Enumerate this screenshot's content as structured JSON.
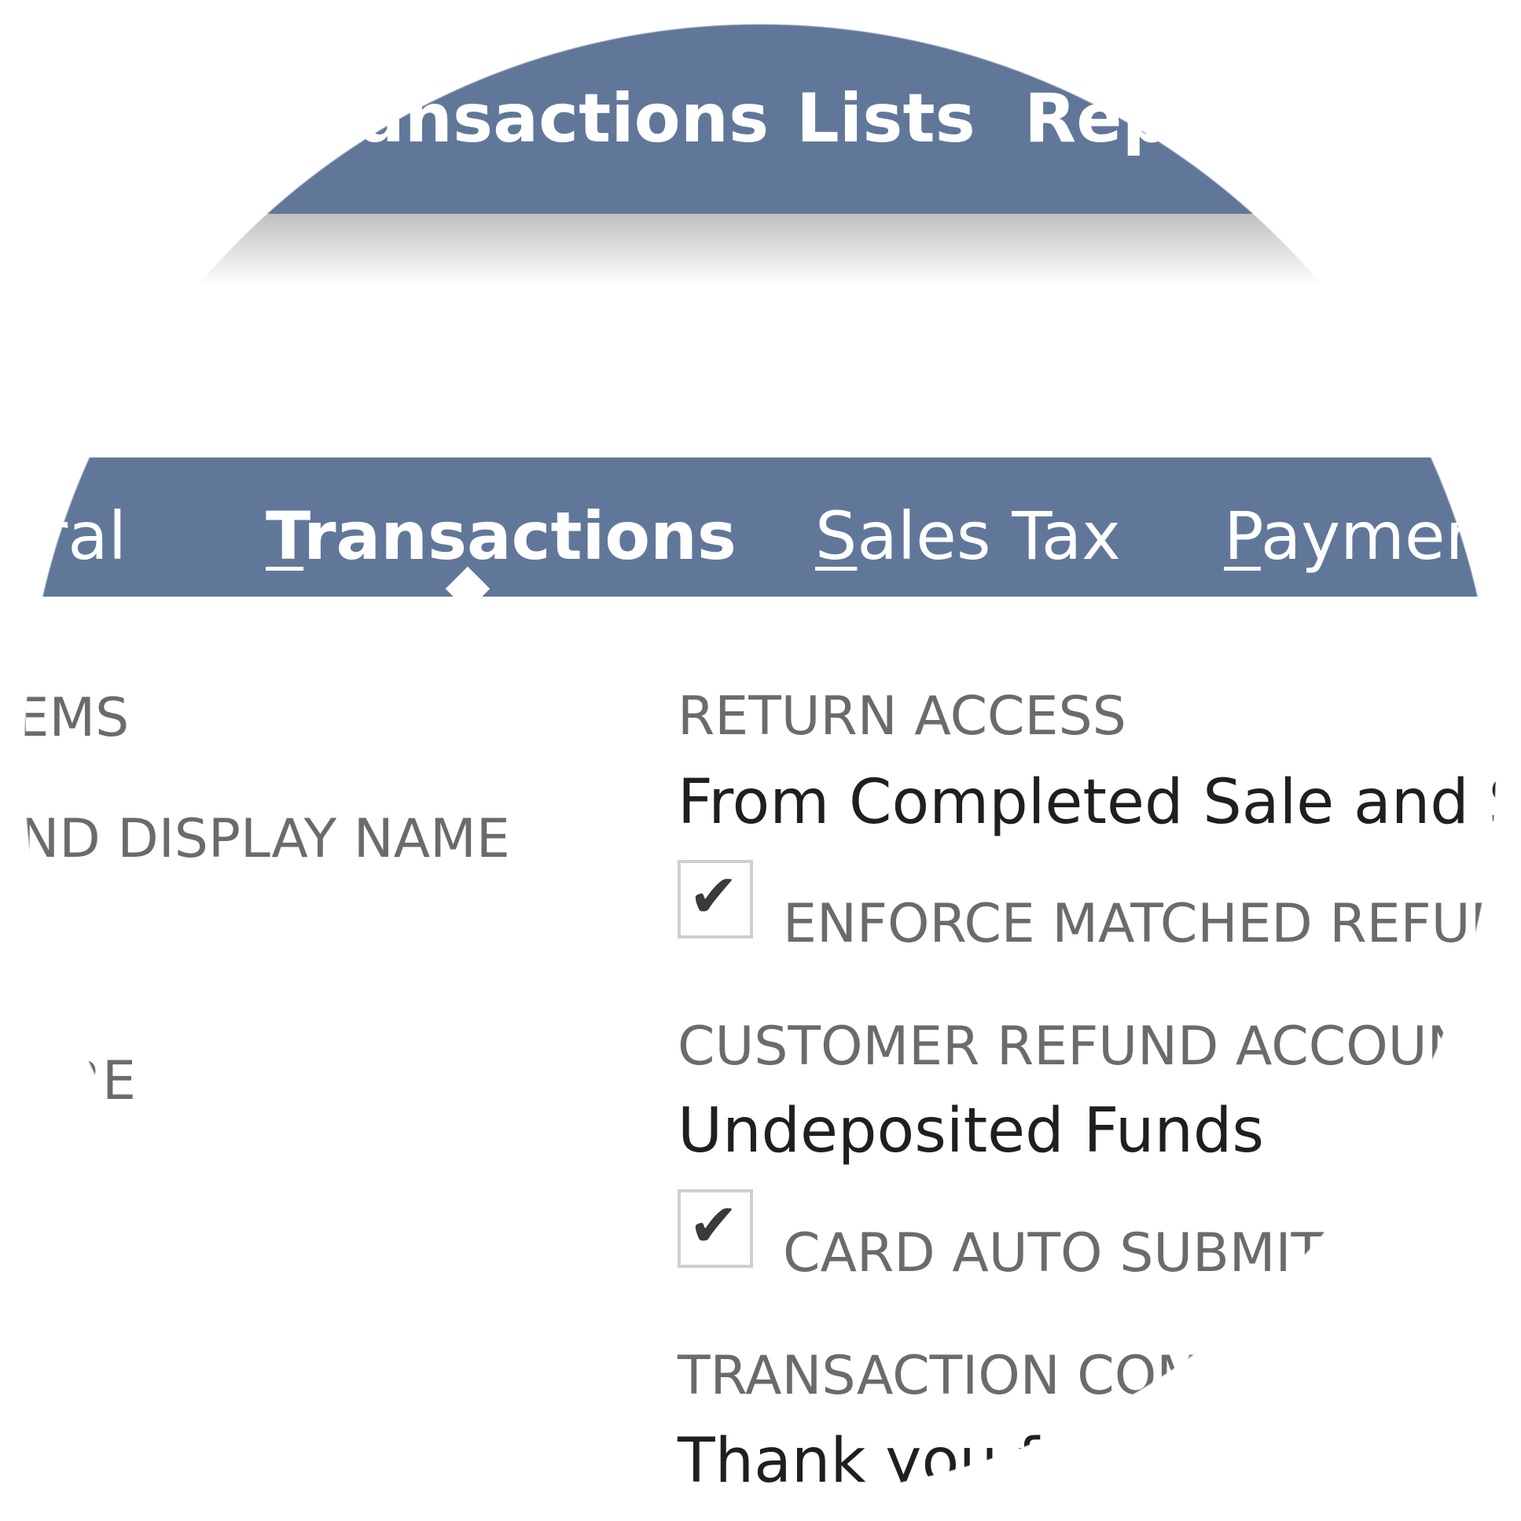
{
  "top_nav": {
    "items": [
      "Transactions",
      "Lists",
      "Repo"
    ]
  },
  "sub_nav": {
    "tabs": [
      {
        "label": "eral",
        "active": false
      },
      {
        "first": "T",
        "rest": "ransactions",
        "active": true
      },
      {
        "first": "S",
        "rest": "ales Tax",
        "active": false
      },
      {
        "first": "P",
        "rest": "ayment",
        "active": false
      }
    ]
  },
  "left_column": {
    "labels": [
      "TEMS",
      "AND DISPLAY NAME",
      "'RE"
    ]
  },
  "right_column": {
    "return_access_label": "RETURN ACCESS",
    "return_access_value": "From Completed Sale and Sta",
    "enforce_matched_refund_label": "ENFORCE MATCHED REFUN",
    "enforce_matched_refund_checked": true,
    "customer_refund_account_label": "CUSTOMER REFUND ACCOUNT",
    "customer_refund_account_value": "Undeposited Funds",
    "card_auto_submit_label": "CARD AUTO SUBMIT",
    "card_auto_submit_checked": true,
    "transaction_comp_label": "TRANSACTION COMP",
    "transaction_comp_value": "Thank you for"
  },
  "checkmark_glyph": "✔",
  "colors": {
    "nav_bg": "#61779a",
    "label_text": "#6b6b6b",
    "value_text": "#1f1f1f",
    "checkbox_border": "#cfcfcf"
  }
}
